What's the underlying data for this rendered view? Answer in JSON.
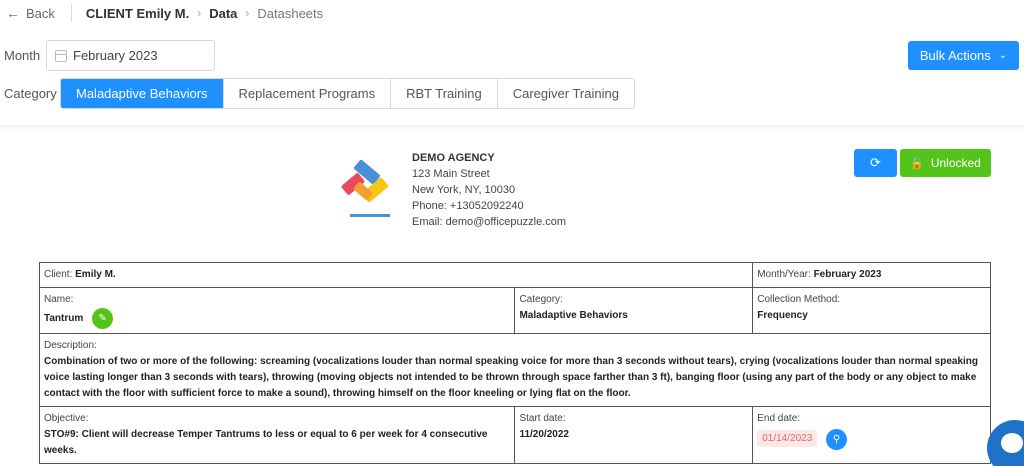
{
  "nav": {
    "back_label": "Back",
    "client_crumb": "CLIENT Emily M.",
    "data_crumb": "Data",
    "datasheets_crumb": "Datasheets"
  },
  "filters": {
    "month_label": "Month",
    "month_value": "February 2023",
    "category_label": "Category",
    "bulk_actions_label": "Bulk Actions"
  },
  "tabs": [
    {
      "label": "Maladaptive Behaviors",
      "active": true
    },
    {
      "label": "Replacement Programs",
      "active": false
    },
    {
      "label": "RBT Training",
      "active": false
    },
    {
      "label": "Caregiver Training",
      "active": false
    }
  ],
  "agency": {
    "name": "DEMO AGENCY",
    "address1": "123 Main Street",
    "address2": "New York, NY, 10030",
    "phone": "Phone: +13052092240",
    "email": "Email: demo@officepuzzle.com"
  },
  "actions": {
    "unlocked_label": "Unlocked"
  },
  "sheet": {
    "client_label": "Client:",
    "client_value": "Emily M.",
    "month_year_label": "Month/Year:",
    "month_year_value": "February 2023",
    "name_label": "Name:",
    "name_value": "Tantrum",
    "category_label": "Category:",
    "category_value": "Maladaptive Behaviors",
    "method_label": "Collection Method:",
    "method_value": "Frequency",
    "description_label": "Description:",
    "description_value": "Combination of two or more of the following: screaming (vocalizations louder than normal speaking voice for more than 3 seconds without tears), crying (vocalizations louder than normal speaking voice lasting longer than 3 seconds with tears), throwing (moving objects not intended to be thrown through space farther than 3 ft), banging floor (using any part of the body or any object to make contact with the floor with sufficient force to make a sound), throwing himself on the floor kneeling or lying flat on the floor.",
    "objective_label": "Objective:",
    "objective_value": "STO#9: Client will decrease Temper Tantrums to less or equal to 6 per week for 4 consecutive weeks.",
    "start_label": "Start date:",
    "start_value": "11/20/2022",
    "end_label": "End date:",
    "end_value": "01/14/2023"
  },
  "colors": {
    "primary": "#1e90ff",
    "success": "#52c41a",
    "danger_bg": "#fde8e8",
    "danger_text": "#e06666"
  }
}
